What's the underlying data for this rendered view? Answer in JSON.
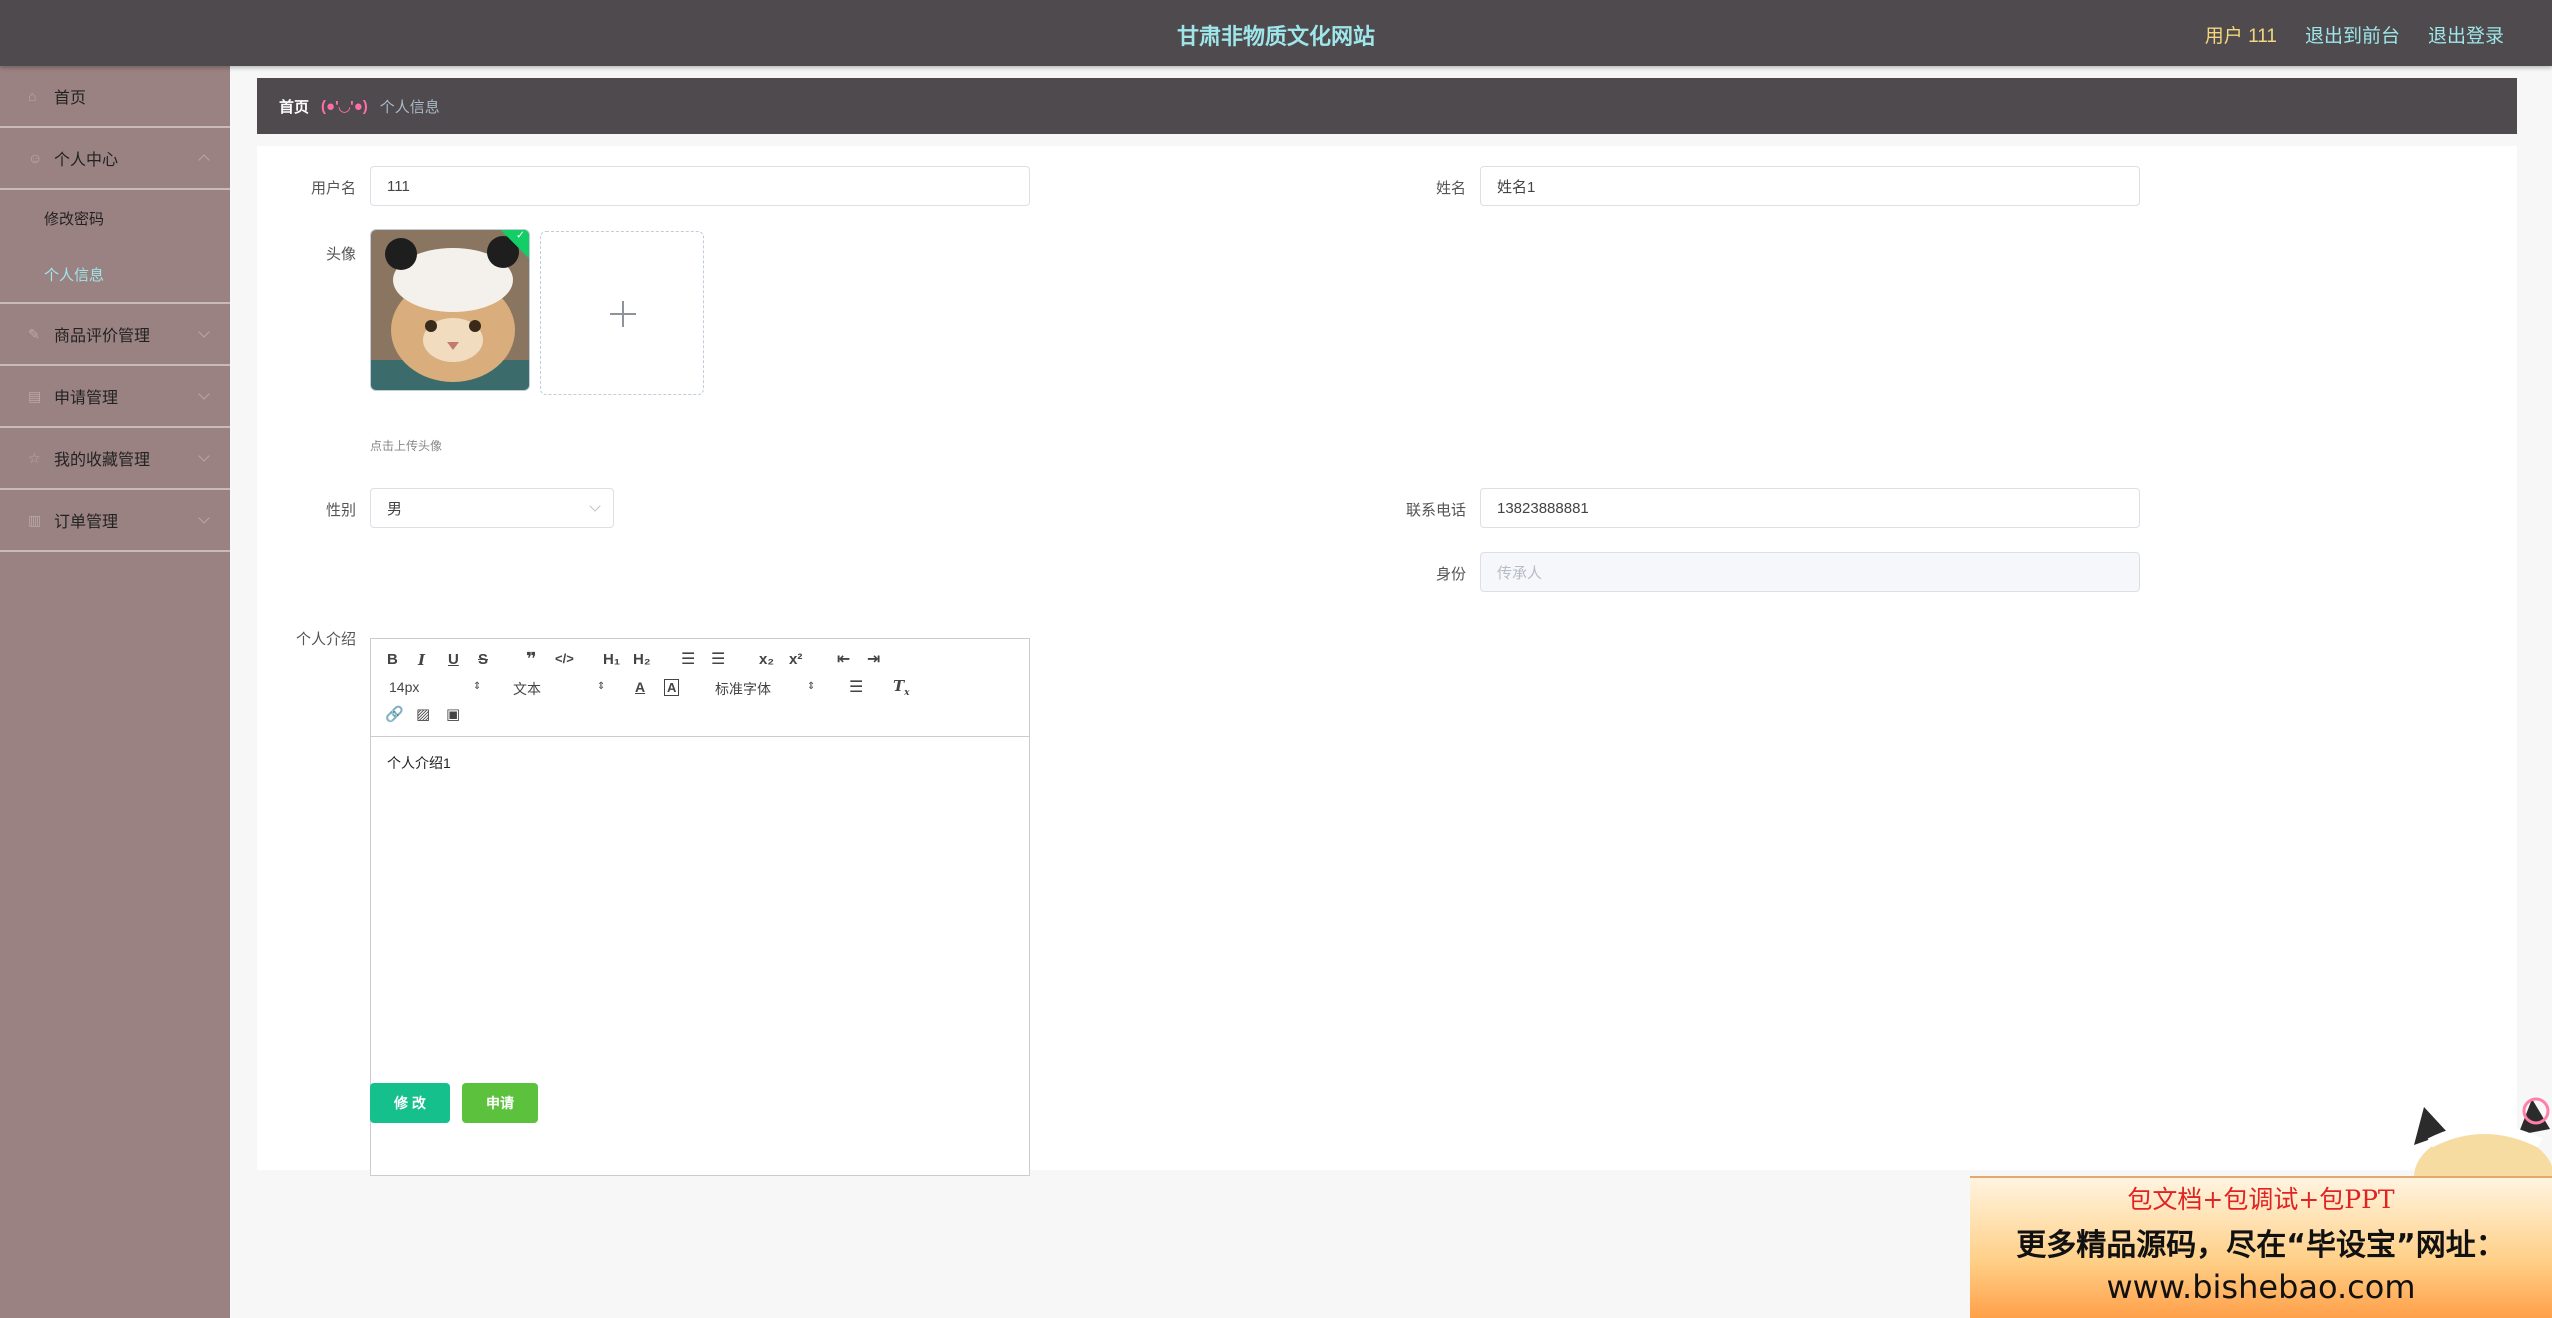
{
  "header": {
    "title": "甘肃非物质文化网站",
    "user_label": "用户 111",
    "back_label": "退出到前台",
    "logout_label": "退出登录"
  },
  "sidebar": {
    "items": [
      {
        "label": "首页",
        "icon": "home-icon"
      },
      {
        "label": "个人中心",
        "icon": "user-icon",
        "children": [
          "修改密码",
          "个人信息"
        ]
      },
      {
        "label": "商品评价管理",
        "icon": "chat-icon"
      },
      {
        "label": "申请管理",
        "icon": "doc-icon"
      },
      {
        "label": "我的收藏管理",
        "icon": "star-icon"
      },
      {
        "label": "订单管理",
        "icon": "chart-icon"
      }
    ],
    "active_child": "个人信息"
  },
  "breadcrumb": {
    "home": "首页",
    "separator": "(●'◡'●)",
    "current": "个人信息"
  },
  "form": {
    "username_label": "用户名",
    "username_value": "111",
    "name_label": "姓名",
    "name_value": "姓名1",
    "avatar_label": "头像",
    "upload_tip": "点击上传头像",
    "gender_label": "性别",
    "gender_value": "男",
    "phone_label": "联系电话",
    "phone_value": "13823888881",
    "identity_label": "身份",
    "identity_placeholder": "传承人",
    "intro_label": "个人介绍",
    "intro_value": "个人介绍1"
  },
  "editor_toolbar": {
    "font_size": "14px",
    "heading": "文本",
    "font_family": "标准字体",
    "h1": "H₁",
    "h2": "H₂",
    "sub": "x₂",
    "sup": "x²"
  },
  "buttons": {
    "edit_label": "修 改",
    "apply_label": "申请"
  },
  "promo": {
    "line1": "包文档+包调试+包PPT",
    "line2": "更多精品源码，尽在“毕设宝”网址：",
    "line3": "www.bishebao.com"
  },
  "colors": {
    "header_bg": "#4f4a4d",
    "title_color": "#9ee6e9",
    "sidebar_bg": "#9b8282",
    "edit_button": "#16c08c",
    "apply_button": "#5cc23e"
  }
}
